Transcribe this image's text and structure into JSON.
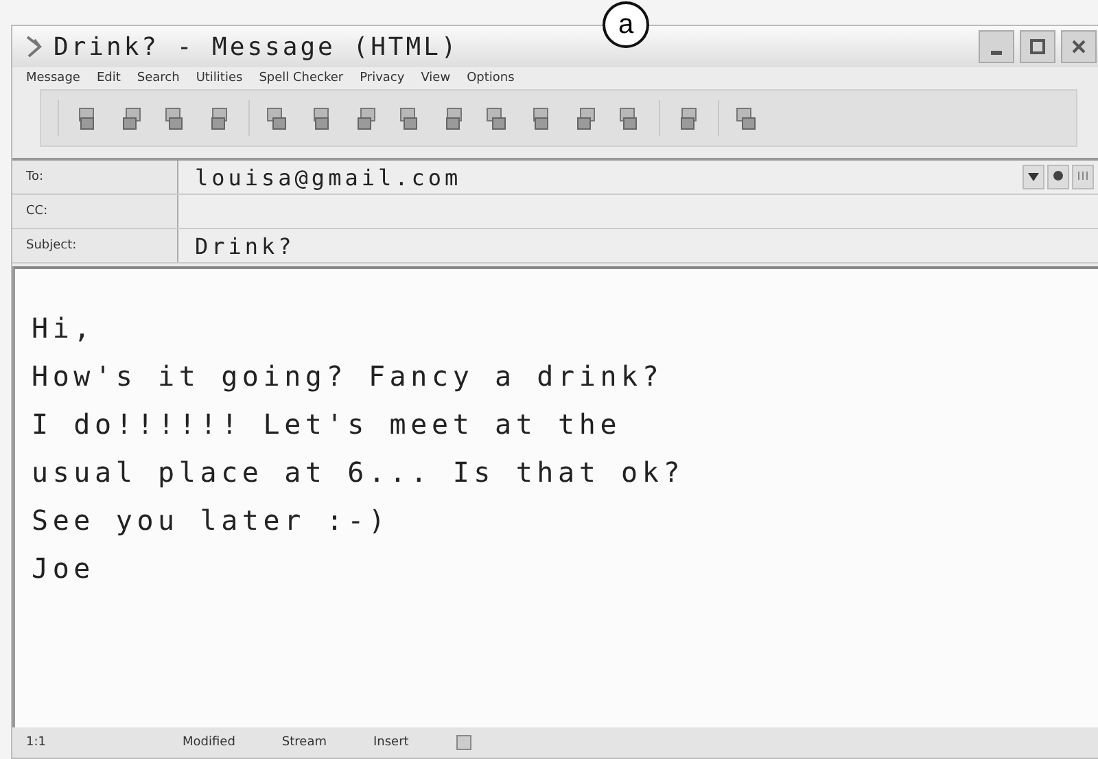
{
  "annotation": "a",
  "window": {
    "title": "Drink? - Message (HTML)"
  },
  "menu": [
    "Message",
    "Edit",
    "Search",
    "Utilities",
    "Spell Checker",
    "Privacy",
    "View",
    "Options"
  ],
  "headers": [
    {
      "label": "To:",
      "value": "louisa@gmail.com",
      "kind": "address"
    },
    {
      "label": "CC:",
      "kind": "plain"
    },
    {
      "label": "Subject:",
      "value": "Drink?",
      "kind": "plain"
    }
  ],
  "body": [
    "Hi,",
    "How's it going? Fancy a drink?",
    "I do!!!!!! Let's meet at the",
    "usual place at 6... Is that ok?",
    "See you later :-)",
    "Joe"
  ],
  "status_bar": [
    "1:1",
    "Modified",
    "Stream",
    "Insert"
  ]
}
